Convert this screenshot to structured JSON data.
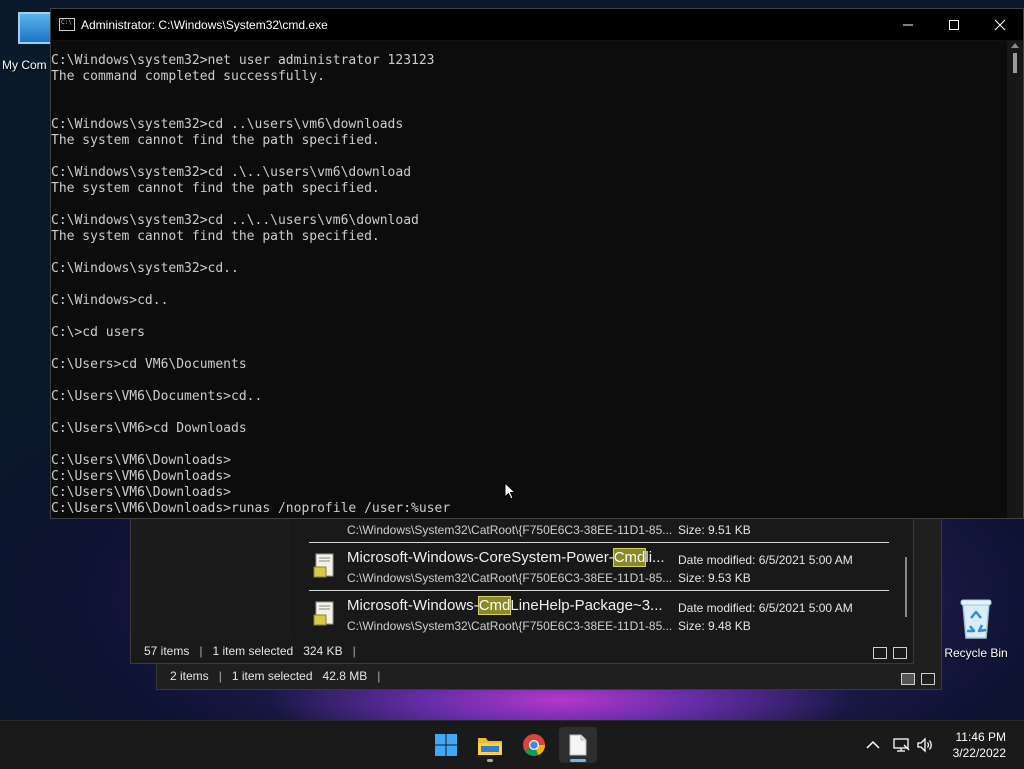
{
  "desktop": {
    "icons": [
      {
        "label": "My Com"
      },
      {
        "label": "Recycle Bin"
      }
    ]
  },
  "cmd_window": {
    "title": "Administrator: C:\\Windows\\System32\\cmd.exe",
    "lines": [
      "C:\\Windows\\system32>net user administrator 123123",
      "The command completed successfully.",
      "",
      "",
      "C:\\Windows\\system32>cd ..\\users\\vm6\\downloads",
      "The system cannot find the path specified.",
      "",
      "C:\\Windows\\system32>cd .\\..\\users\\vm6\\download",
      "The system cannot find the path specified.",
      "",
      "C:\\Windows\\system32>cd ..\\..\\users\\vm6\\download",
      "The system cannot find the path specified.",
      "",
      "C:\\Windows\\system32>cd..",
      "",
      "C:\\Windows>cd..",
      "",
      "C:\\>cd users",
      "",
      "C:\\Users>cd VM6\\Documents",
      "",
      "C:\\Users\\VM6\\Documents>cd..",
      "",
      "C:\\Users\\VM6>cd Downloads",
      "",
      "C:\\Users\\VM6\\Downloads>",
      "C:\\Users\\VM6\\Downloads>",
      "C:\\Users\\VM6\\Downloads>",
      "C:\\Users\\VM6\\Downloads>runas /noprofile /user:%user"
    ]
  },
  "explorer_front": {
    "results": [
      {
        "name_pre": "",
        "name_hl": "",
        "name_post": "",
        "path": "C:\\Windows\\System32\\CatRoot\\{F750E6C3-38EE-11D1-85...",
        "date": "",
        "size": "Size: 9.51 KB"
      },
      {
        "name_pre": "Microsoft-Windows-CoreSystem-Power-",
        "name_hl": "Cmd",
        "name_post": "li...",
        "path": "C:\\Windows\\System32\\CatRoot\\{F750E6C3-38EE-11D1-85...",
        "date": "Date modified: 6/5/2021 5:00 AM",
        "size": "Size: 9.53 KB"
      },
      {
        "name_pre": "Microsoft-Windows-",
        "name_hl": "Cmd",
        "name_post": "LineHelp-Package~3...",
        "path": "C:\\Windows\\System32\\CatRoot\\{F750E6C3-38EE-11D1-85...",
        "date": "Date modified: 6/5/2021 5:00 AM",
        "size": "Size: 9.48 KB"
      }
    ],
    "status": {
      "items": "57 items",
      "selected": "1 item selected",
      "size": "324 KB",
      "sep": "|"
    }
  },
  "explorer_back": {
    "status": {
      "items": "2 items",
      "selected": "1 item selected",
      "size": "42.8 MB",
      "sep": "|"
    }
  },
  "taskbar": {
    "apps": [
      {
        "name": "start",
        "icon": "windows-logo-icon"
      },
      {
        "name": "file-explorer",
        "icon": "folder-icon"
      },
      {
        "name": "chrome",
        "icon": "chrome-icon"
      },
      {
        "name": "notepad",
        "icon": "document-icon"
      }
    ],
    "time": "11:46 PM",
    "date": "3/22/2022"
  },
  "colors": {
    "console_text": "#cccccc",
    "highlight": "#8a8a2a",
    "accent": "#6cb8f0"
  }
}
